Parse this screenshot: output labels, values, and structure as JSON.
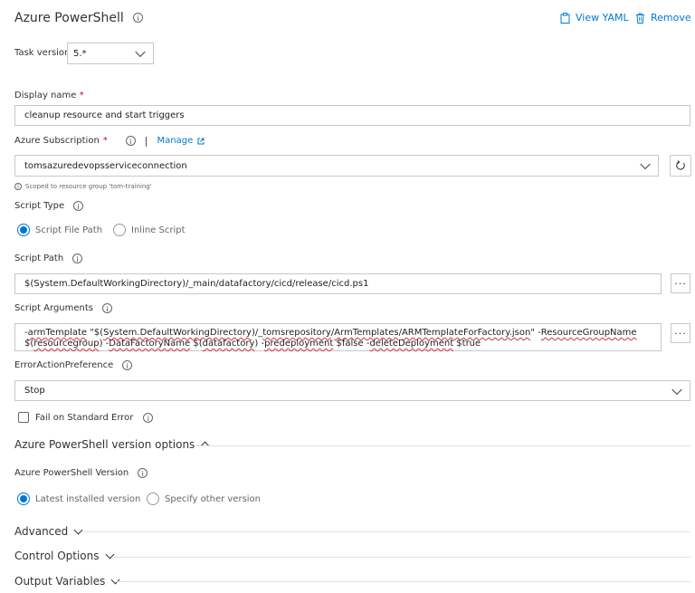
{
  "header": {
    "title": "Azure PowerShell",
    "view_yaml": "View YAML",
    "remove": "Remove"
  },
  "task_version": {
    "label": "Task version",
    "value": "5.*"
  },
  "display_name": {
    "label": "Display name",
    "required": "*",
    "value": "cleanup resource and start triggers"
  },
  "subscription": {
    "label": "Azure Subscription",
    "required": "*",
    "separator": "|",
    "manage": "Manage",
    "value": "tomsazuredevopsserviceconnection",
    "scope_note": "Scoped to resource group 'tom-training'"
  },
  "script_type": {
    "label": "Script Type",
    "options": [
      "Script File Path",
      "Inline Script"
    ],
    "selected": "Script File Path"
  },
  "script_path": {
    "label": "Script Path",
    "value": "$(System.DefaultWorkingDirectory)/_main/datafactory/cicd/release/cicd.ps1"
  },
  "script_arguments": {
    "label": "Script Arguments",
    "line1_parts": [
      "-",
      "armTemplate",
      " \"$(",
      "System.DefaultWorkingDirectory",
      ")/_",
      "tomsrepository",
      "/",
      "ArmTemplates",
      "/",
      "ARMTemplateForFactory.json",
      "\"  -",
      "ResourceGroupName"
    ],
    "line2_parts": [
      "$(",
      "resourcegroup",
      ") -",
      "DataFactoryName",
      " $(",
      "datafactory",
      ") -",
      "predeployment",
      " $false -",
      "deleteDeployment",
      " $true"
    ]
  },
  "error_action": {
    "label": "ErrorActionPreference",
    "value": "Stop"
  },
  "fail_on_stderr": {
    "label": "Fail on Standard Error",
    "checked": false
  },
  "version_options": {
    "title": "Azure PowerShell version options",
    "version_label": "Azure PowerShell Version",
    "options": [
      "Latest installed version",
      "Specify other version"
    ],
    "selected": "Latest installed version"
  },
  "sections": {
    "advanced": "Advanced",
    "control_options": "Control Options",
    "output_variables": "Output Variables"
  },
  "colors": {
    "accent": "#0078d4",
    "required": "#c50f1f",
    "squiggle": "#d13438"
  },
  "icons": [
    "info-icon",
    "clipboard-icon",
    "trash-icon",
    "external-link-icon",
    "refresh-icon",
    "chevron-down-icon",
    "chevron-up-icon",
    "ellipsis-icon"
  ]
}
